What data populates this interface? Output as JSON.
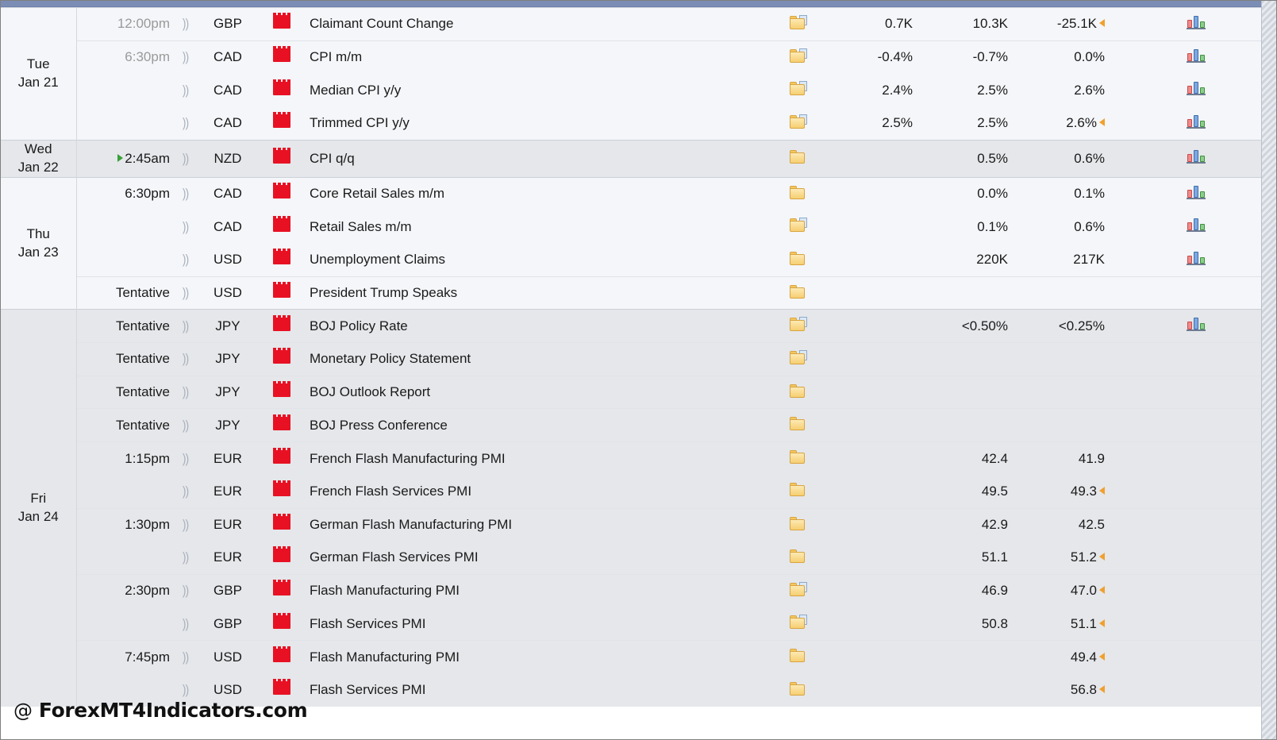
{
  "watermark": {
    "text": "@ ForexMT4Indicators.com",
    "at": "@",
    "site": "ForexMT4Indicators.com"
  },
  "colors": {
    "accent_bar": "#7b8db4",
    "positive": "#1a8a2e",
    "negative": "#c00018",
    "neutral": "#1a1a1a",
    "impact_high": "#e81123",
    "revised_marker": "#f0a030",
    "next_event_marker": "#3aa03a",
    "row_light": "#f4f6f9",
    "row_dark": "#e5e7ea"
  },
  "icons": {
    "speaker": "speaker-icon",
    "impact": "impact-high-icon",
    "detail_folder": "detail-folder-icon",
    "detail_folder_page": "detail-folder-page-icon",
    "graph": "history-graph-icon",
    "next_marker": "next-event-triangle-icon",
    "revised_marker": "revised-value-triangle-icon"
  },
  "days": [
    {
      "weekday": "Tue",
      "monthday": "Jan 21",
      "shade": "light",
      "rows": [
        {
          "time": "12:00pm",
          "time_state": "past",
          "next": false,
          "group_start": true,
          "currency": "GBP",
          "impact": "high",
          "event": "Claimant Count Change",
          "detail": "folder-page",
          "actual": "0.7K",
          "actual_tone": "positive",
          "forecast": "10.3K",
          "forecast_tone": "neutral",
          "previous": "-25.1K",
          "previous_tone": "positive",
          "previous_revised": true,
          "graph": true
        },
        {
          "time": "6:30pm",
          "time_state": "past",
          "next": false,
          "group_start": true,
          "currency": "CAD",
          "impact": "high",
          "event": "CPI m/m",
          "detail": "folder-page",
          "actual": "-0.4%",
          "actual_tone": "positive",
          "forecast": "-0.7%",
          "forecast_tone": "neutral",
          "previous": "0.0%",
          "previous_tone": "neutral",
          "previous_revised": false,
          "graph": true
        },
        {
          "time": "",
          "time_state": "past",
          "next": false,
          "group_start": false,
          "currency": "CAD",
          "impact": "high",
          "event": "Median CPI y/y",
          "detail": "folder-page",
          "actual": "2.4%",
          "actual_tone": "negative",
          "forecast": "2.5%",
          "forecast_tone": "neutral",
          "previous": "2.6%",
          "previous_tone": "neutral",
          "previous_revised": false,
          "graph": true
        },
        {
          "time": "",
          "time_state": "past",
          "next": false,
          "group_start": false,
          "currency": "CAD",
          "impact": "high",
          "event": "Trimmed CPI y/y",
          "detail": "folder-page",
          "actual": "2.5%",
          "actual_tone": "neutral",
          "forecast": "2.5%",
          "forecast_tone": "neutral",
          "previous": "2.6%",
          "previous_tone": "negative",
          "previous_revised": true,
          "graph": true
        }
      ]
    },
    {
      "weekday": "Wed",
      "monthday": "Jan 22",
      "shade": "dark",
      "rows": [
        {
          "time": "2:45am",
          "time_state": "future",
          "next": true,
          "group_start": true,
          "currency": "NZD",
          "impact": "high",
          "event": "CPI q/q",
          "detail": "folder",
          "actual": "",
          "actual_tone": "neutral",
          "forecast": "0.5%",
          "forecast_tone": "neutral",
          "previous": "0.6%",
          "previous_tone": "neutral",
          "previous_revised": false,
          "graph": true
        }
      ]
    },
    {
      "weekday": "Thu",
      "monthday": "Jan 23",
      "shade": "light",
      "rows": [
        {
          "time": "6:30pm",
          "time_state": "future",
          "next": false,
          "group_start": true,
          "currency": "CAD",
          "impact": "high",
          "event": "Core Retail Sales m/m",
          "detail": "folder",
          "actual": "",
          "actual_tone": "neutral",
          "forecast": "0.0%",
          "forecast_tone": "neutral",
          "previous": "0.1%",
          "previous_tone": "neutral",
          "previous_revised": false,
          "graph": true
        },
        {
          "time": "",
          "time_state": "future",
          "next": false,
          "group_start": false,
          "currency": "CAD",
          "impact": "high",
          "event": "Retail Sales m/m",
          "detail": "folder-page",
          "actual": "",
          "actual_tone": "neutral",
          "forecast": "0.1%",
          "forecast_tone": "neutral",
          "previous": "0.6%",
          "previous_tone": "neutral",
          "previous_revised": false,
          "graph": true
        },
        {
          "time": "",
          "time_state": "future",
          "next": false,
          "group_start": false,
          "currency": "USD",
          "impact": "high",
          "event": "Unemployment Claims",
          "detail": "folder",
          "actual": "",
          "actual_tone": "neutral",
          "forecast": "220K",
          "forecast_tone": "neutral",
          "previous": "217K",
          "previous_tone": "neutral",
          "previous_revised": false,
          "graph": true
        },
        {
          "time": "Tentative",
          "time_state": "future",
          "next": false,
          "group_start": true,
          "currency": "USD",
          "impact": "high",
          "event": "President Trump Speaks",
          "detail": "folder",
          "actual": "",
          "actual_tone": "neutral",
          "forecast": "",
          "forecast_tone": "neutral",
          "previous": "",
          "previous_tone": "neutral",
          "previous_revised": false,
          "graph": false
        }
      ]
    },
    {
      "weekday": "Fri",
      "monthday": "Jan 24",
      "shade": "dark",
      "rows": [
        {
          "time": "Tentative",
          "time_state": "future",
          "next": false,
          "group_start": true,
          "currency": "JPY",
          "impact": "high",
          "event": "BOJ Policy Rate",
          "detail": "folder-page",
          "actual": "",
          "actual_tone": "neutral",
          "forecast": "<0.50%",
          "forecast_tone": "neutral",
          "previous": "<0.25%",
          "previous_tone": "neutral",
          "previous_revised": false,
          "graph": true
        },
        {
          "time": "Tentative",
          "time_state": "future",
          "next": false,
          "group_start": true,
          "currency": "JPY",
          "impact": "high",
          "event": "Monetary Policy Statement",
          "detail": "folder-page",
          "actual": "",
          "actual_tone": "neutral",
          "forecast": "",
          "forecast_tone": "neutral",
          "previous": "",
          "previous_tone": "neutral",
          "previous_revised": false,
          "graph": false
        },
        {
          "time": "Tentative",
          "time_state": "future",
          "next": false,
          "group_start": true,
          "currency": "JPY",
          "impact": "high",
          "event": "BOJ Outlook Report",
          "detail": "folder",
          "actual": "",
          "actual_tone": "neutral",
          "forecast": "",
          "forecast_tone": "neutral",
          "previous": "",
          "previous_tone": "neutral",
          "previous_revised": false,
          "graph": false
        },
        {
          "time": "Tentative",
          "time_state": "future",
          "next": false,
          "group_start": true,
          "currency": "JPY",
          "impact": "high",
          "event": "BOJ Press Conference",
          "detail": "folder",
          "actual": "",
          "actual_tone": "neutral",
          "forecast": "",
          "forecast_tone": "neutral",
          "previous": "",
          "previous_tone": "neutral",
          "previous_revised": false,
          "graph": false
        },
        {
          "time": "1:15pm",
          "time_state": "future",
          "next": false,
          "group_start": true,
          "currency": "EUR",
          "impact": "high",
          "event": "French Flash Manufacturing PMI",
          "detail": "folder",
          "actual": "",
          "actual_tone": "neutral",
          "forecast": "42.4",
          "forecast_tone": "neutral",
          "previous": "41.9",
          "previous_tone": "neutral",
          "previous_revised": false,
          "graph": false
        },
        {
          "time": "",
          "time_state": "future",
          "next": false,
          "group_start": false,
          "currency": "EUR",
          "impact": "high",
          "event": "French Flash Services PMI",
          "detail": "folder",
          "actual": "",
          "actual_tone": "neutral",
          "forecast": "49.5",
          "forecast_tone": "neutral",
          "previous": "49.3",
          "previous_tone": "positive",
          "previous_revised": true,
          "graph": false
        },
        {
          "time": "1:30pm",
          "time_state": "future",
          "next": false,
          "group_start": true,
          "currency": "EUR",
          "impact": "high",
          "event": "German Flash Manufacturing PMI",
          "detail": "folder",
          "actual": "",
          "actual_tone": "neutral",
          "forecast": "42.9",
          "forecast_tone": "neutral",
          "previous": "42.5",
          "previous_tone": "neutral",
          "previous_revised": false,
          "graph": false
        },
        {
          "time": "",
          "time_state": "future",
          "next": false,
          "group_start": false,
          "currency": "EUR",
          "impact": "high",
          "event": "German Flash Services PMI",
          "detail": "folder",
          "actual": "",
          "actual_tone": "neutral",
          "forecast": "51.1",
          "forecast_tone": "neutral",
          "previous": "51.2",
          "previous_tone": "neutral",
          "previous_revised": true,
          "graph": false
        },
        {
          "time": "2:30pm",
          "time_state": "future",
          "next": false,
          "group_start": true,
          "currency": "GBP",
          "impact": "high",
          "event": "Flash Manufacturing PMI",
          "detail": "folder-page",
          "actual": "",
          "actual_tone": "neutral",
          "forecast": "46.9",
          "forecast_tone": "neutral",
          "previous": "47.0",
          "previous_tone": "neutral",
          "previous_revised": true,
          "graph": false
        },
        {
          "time": "",
          "time_state": "future",
          "next": false,
          "group_start": false,
          "currency": "GBP",
          "impact": "high",
          "event": "Flash Services PMI",
          "detail": "folder-page",
          "actual": "",
          "actual_tone": "neutral",
          "forecast": "50.8",
          "forecast_tone": "neutral",
          "previous": "51.1",
          "previous_tone": "neutral",
          "previous_revised": true,
          "graph": false
        },
        {
          "time": "7:45pm",
          "time_state": "future",
          "next": false,
          "group_start": true,
          "currency": "USD",
          "impact": "high",
          "event": "Flash Manufacturing PMI",
          "detail": "folder",
          "actual": "",
          "actual_tone": "neutral",
          "forecast": "",
          "forecast_tone": "neutral",
          "previous": "49.4",
          "previous_tone": "positive",
          "previous_revised": true,
          "graph": false
        },
        {
          "time": "",
          "time_state": "future",
          "next": false,
          "group_start": false,
          "currency": "USD",
          "impact": "high",
          "event": "Flash Services PMI",
          "detail": "folder",
          "actual": "",
          "actual_tone": "neutral",
          "forecast": "",
          "forecast_tone": "neutral",
          "previous": "56.8",
          "previous_tone": "negative",
          "previous_revised": true,
          "graph": false
        }
      ]
    }
  ]
}
